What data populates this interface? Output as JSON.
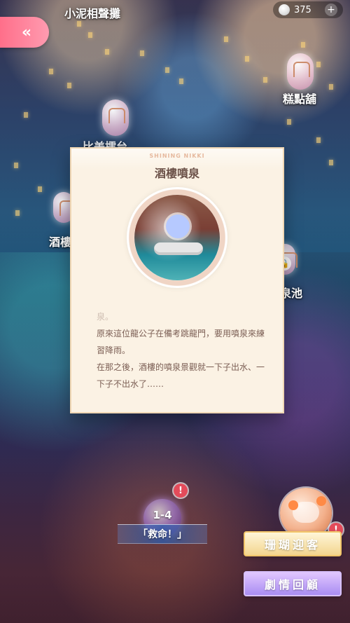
{
  "top": {
    "back_label": "«",
    "currency_amount": "375",
    "plus_label": "+"
  },
  "map": {
    "labels": {
      "xiao_ni": "小泥相聲攤",
      "pastry": "糕點舖",
      "partial_left": "比美擂台",
      "wine_partial": "酒樓",
      "spring_partial": "泉池"
    }
  },
  "dialog": {
    "brand": "SHINING NIKKI",
    "title": "酒樓噴泉",
    "text": [
      "泉。",
      "原來這位龍公子在備考跳龍門，要用噴泉來練習降雨。",
      "在那之後，酒樓的噴泉景觀就一下子出水、一下子不出水了……"
    ]
  },
  "bottom": {
    "stage_code": "1-4",
    "stage_title": "「救命！」",
    "btn_receive": "珊瑚迎客",
    "btn_story": "劇情回顧",
    "badge": "!"
  },
  "colors": {
    "back_button": "#ff7f96",
    "dialog_bg": "#fbf2e4",
    "text": "#7b5e54"
  },
  "icons": {
    "coin": "coin-icon",
    "lock": "lock-icon",
    "back": "back-icon",
    "plus": "plus-icon"
  }
}
